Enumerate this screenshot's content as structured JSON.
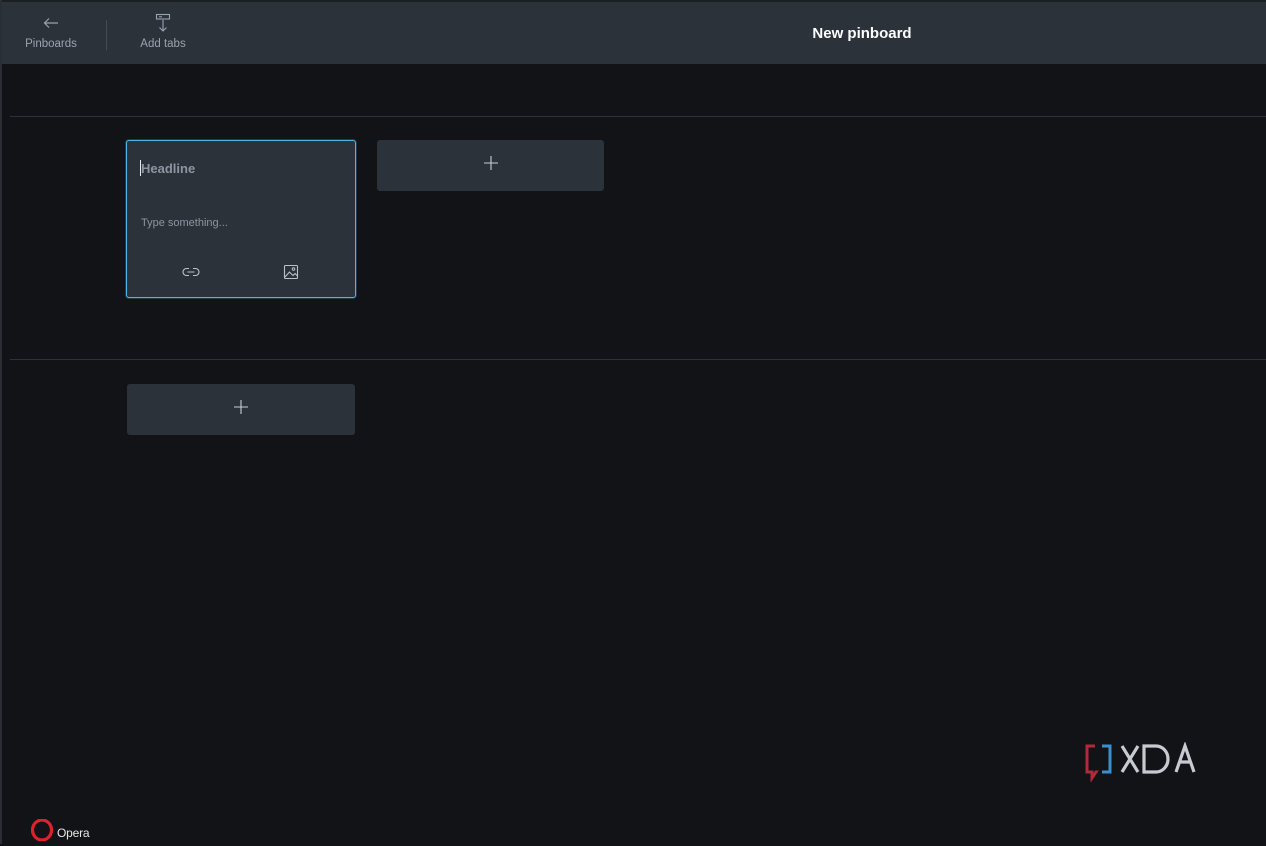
{
  "toolbar": {
    "back_label": "Pinboards",
    "back_icon": "arrow-left-icon",
    "add_tabs_label": "Add tabs",
    "add_tabs_icon": "add-tabs-icon"
  },
  "header": {
    "title": "New pinboard"
  },
  "note_card": {
    "headline_placeholder": "Headline",
    "body_placeholder": "Type something...",
    "tools": [
      "link-icon",
      "image-icon"
    ]
  },
  "add_buttons": {
    "icon": "plus-icon"
  },
  "branding": {
    "opera_label": "Opera",
    "watermark": "XDA"
  },
  "colors": {
    "background": "#111316",
    "surface": "#2b323a",
    "focus_border": "#4fb3e8",
    "opera_red": "#e0212b"
  }
}
